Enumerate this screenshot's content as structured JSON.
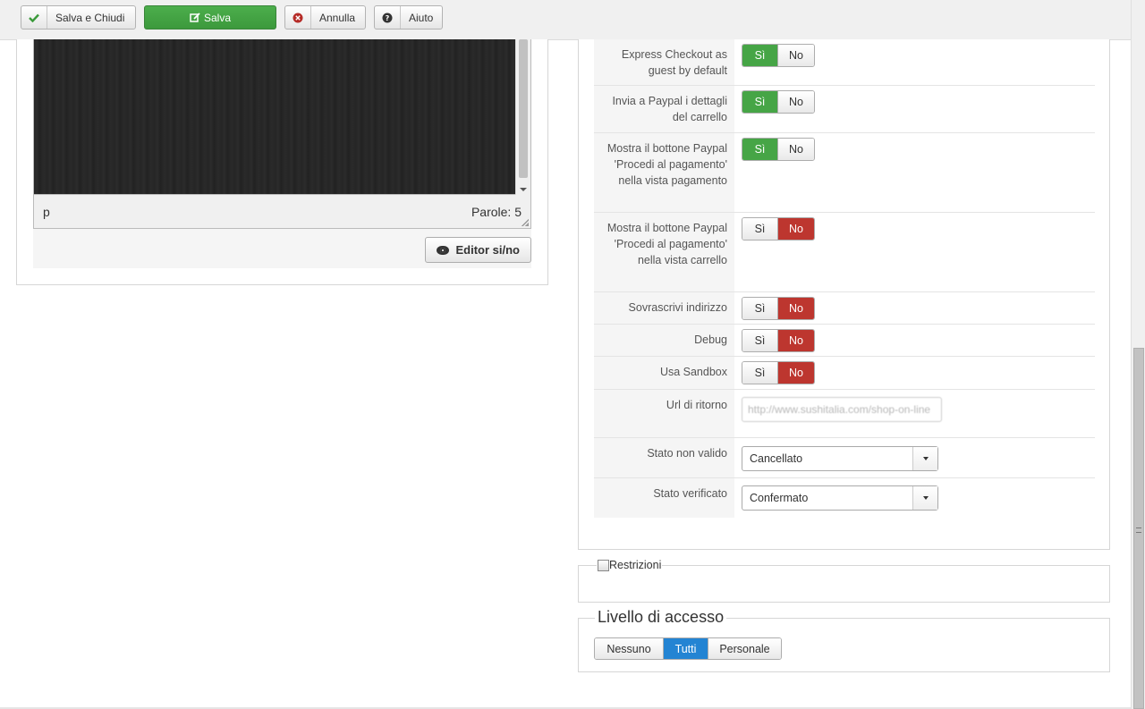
{
  "toolbar": {
    "save_close_label": "Salva e Chiudi",
    "save_label": "Salva",
    "cancel_label": "Annulla",
    "help_label": "Aiuto"
  },
  "editor": {
    "path": "p",
    "word_count": "Parole: 5",
    "toggle_label": "Editor si/no"
  },
  "params": {
    "yes": "Sì",
    "no": "No",
    "express_checkout_label": "Express Checkout as guest by default",
    "express_checkout_value": "yes",
    "send_cart_label": "Invia a Paypal i dettagli del carrello",
    "send_cart_value": "yes",
    "show_btn_payment_label": "Mostra il bottone Paypal 'Procedi al pagamento' nella vista pagamento",
    "show_btn_payment_value": "yes",
    "show_btn_cart_label": "Mostra il bottone Paypal 'Procedi al pagamento' nella vista carrello",
    "show_btn_cart_value": "no",
    "overwrite_address_label": "Sovrascrivi indirizzo",
    "overwrite_address_value": "no",
    "debug_label": "Debug",
    "debug_value": "no",
    "sandbox_label": "Usa Sandbox",
    "sandbox_value": "no",
    "return_url_label": "Url di ritorno",
    "return_url_value": "http://www.sushitalia.com/shop-on-line",
    "invalid_status_label": "Stato non valido",
    "invalid_status_value": "Cancellato",
    "verified_status_label": "Stato verificato",
    "verified_status_value": "Confermato"
  },
  "restrictions": {
    "label": "Restrizioni"
  },
  "access": {
    "title": "Livello di accesso",
    "options": [
      "Nessuno",
      "Tutti",
      "Personale"
    ],
    "selected": "Tutti"
  },
  "colors": {
    "yes_active": "#46a546",
    "no_active": "#bd362f",
    "access_active": "#2384d3",
    "save_green": "#43a443"
  }
}
